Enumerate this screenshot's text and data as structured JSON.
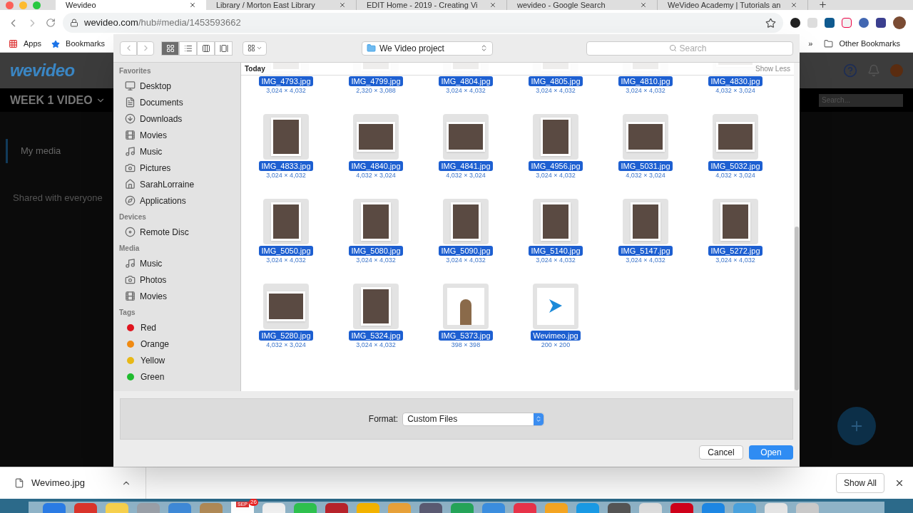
{
  "browser": {
    "tabs": [
      {
        "title": "Wevideo",
        "selected": true
      },
      {
        "title": "Library / Morton East Library",
        "selected": false
      },
      {
        "title": "EDIT Home - 2019 - Creating Vi",
        "selected": false
      },
      {
        "title": "wevideo - Google Search",
        "selected": false
      },
      {
        "title": "WeVideo Academy | Tutorials an",
        "selected": false
      }
    ],
    "url_host": "wevideo.com",
    "url_path": "/hub#media/1453593662",
    "bookmarks": [
      "Apps",
      "Bookmarks"
    ],
    "overflow": "»",
    "other_bookmarks": "Other Bookmarks"
  },
  "page": {
    "logo": "wevideo",
    "project": "WEEK 1 VIDEO",
    "search_placeholder": "Search...",
    "nav": [
      {
        "label": "My media",
        "selected": true
      },
      {
        "label": "Shared with everyone",
        "selected": false
      }
    ]
  },
  "dialog": {
    "location": "We Video project",
    "search_placeholder": "Search",
    "views": [
      {
        "selected": true
      },
      {
        "selected": false
      },
      {
        "selected": false
      },
      {
        "selected": false
      }
    ],
    "sidebar": [
      {
        "title": "Favorites",
        "items": [
          {
            "label": "Desktop"
          },
          {
            "label": "Documents"
          },
          {
            "label": "Downloads"
          },
          {
            "label": "Movies"
          },
          {
            "label": "Music"
          },
          {
            "label": "Pictures"
          },
          {
            "label": "SarahLorraine"
          },
          {
            "label": "Applications"
          }
        ]
      },
      {
        "title": "Devices",
        "items": [
          {
            "label": "Remote Disc"
          }
        ]
      },
      {
        "title": "Media",
        "items": [
          {
            "label": "Music"
          },
          {
            "label": "Photos"
          },
          {
            "label": "Movies"
          }
        ]
      },
      {
        "title": "Tags",
        "items": [
          {
            "label": "Red",
            "color": "#e0141e"
          },
          {
            "label": "Orange",
            "color": "#f08a12"
          },
          {
            "label": "Yellow",
            "color": "#e8b816"
          },
          {
            "label": "Green",
            "color": "#1fbb2e"
          }
        ]
      }
    ],
    "group": "Today",
    "show_less": "Show Less",
    "files": [
      {
        "name": "IMG_4793.jpg",
        "size": "3,024 × 4,032",
        "kind": "portrait",
        "selected": true
      },
      {
        "name": "IMG_4799.jpg",
        "size": "2,320 × 3,088",
        "kind": "portrait",
        "selected": true
      },
      {
        "name": "IMG_4804.jpg",
        "size": "3,024 × 4,032",
        "kind": "portrait",
        "selected": true
      },
      {
        "name": "IMG_4805.jpg",
        "size": "3,024 × 4,032",
        "kind": "portrait",
        "selected": true
      },
      {
        "name": "IMG_4810.jpg",
        "size": "3,024 × 4,032",
        "kind": "portrait",
        "selected": true
      },
      {
        "name": "IMG_4830.jpg",
        "size": "4,032 × 3,024",
        "kind": "landscape",
        "selected": true
      },
      {
        "name": "IMG_4833.jpg",
        "size": "3,024 × 4,032",
        "kind": "portrait",
        "selected": true
      },
      {
        "name": "IMG_4840.jpg",
        "size": "4,032 × 3,024",
        "kind": "landscape",
        "selected": true
      },
      {
        "name": "IMG_4841.jpg",
        "size": "4,032 × 3,024",
        "kind": "landscape",
        "selected": true
      },
      {
        "name": "IMG_4956.jpg",
        "size": "3,024 × 4,032",
        "kind": "portrait",
        "selected": true
      },
      {
        "name": "IMG_5031.jpg",
        "size": "4,032 × 3,024",
        "kind": "landscape",
        "selected": true
      },
      {
        "name": "IMG_5032.jpg",
        "size": "4,032 × 3,024",
        "kind": "landscape",
        "selected": true
      },
      {
        "name": "IMG_5050.jpg",
        "size": "3,024 × 4,032",
        "kind": "portrait",
        "selected": true
      },
      {
        "name": "IMG_5080.jpg",
        "size": "3,024 × 4,032",
        "kind": "portrait",
        "selected": true
      },
      {
        "name": "IMG_5090.jpg",
        "size": "3,024 × 4,032",
        "kind": "portrait",
        "selected": true
      },
      {
        "name": "IMG_5140.jpg",
        "size": "3,024 × 4,032",
        "kind": "portrait",
        "selected": true
      },
      {
        "name": "IMG_5147.jpg",
        "size": "3,024 × 4,032",
        "kind": "portrait",
        "selected": true
      },
      {
        "name": "IMG_5272.jpg",
        "size": "3,024 × 4,032",
        "kind": "portrait",
        "selected": true
      },
      {
        "name": "IMG_5280.jpg",
        "size": "4,032 × 3,024",
        "kind": "landscape",
        "selected": true
      },
      {
        "name": "IMG_5324.jpg",
        "size": "3,024 × 4,032",
        "kind": "portrait",
        "selected": true
      },
      {
        "name": "IMG_5373.jpg",
        "size": "398 × 398",
        "kind": "square",
        "selected": true
      },
      {
        "name": "Wevimeo.jpg",
        "size": "200 × 200",
        "kind": "logo",
        "selected": true
      }
    ],
    "format_label": "Format:",
    "format_value": "Custom Files",
    "cancel": "Cancel",
    "open": "Open"
  },
  "download": {
    "file": "Wevimeo.jpg",
    "show_all": "Show All"
  },
  "dock": {
    "calendar_month": "SEP",
    "calendar_badge": "26"
  }
}
